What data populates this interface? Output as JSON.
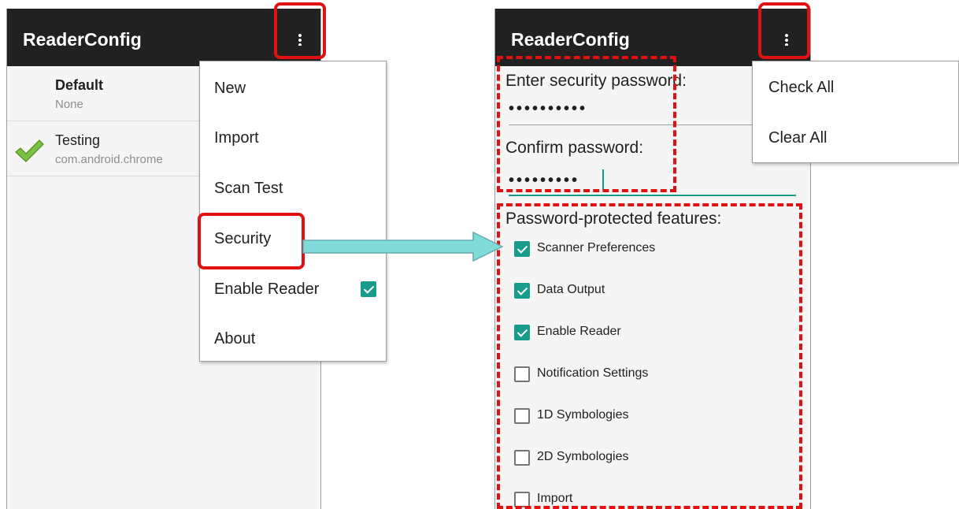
{
  "left_screen": {
    "app_title": "ReaderConfig",
    "profiles": [
      {
        "name": "Default",
        "sub": "None",
        "active": false
      },
      {
        "name": "Testing",
        "sub": "com.android.chrome",
        "active": true
      }
    ],
    "menu": {
      "items": [
        "New",
        "Import",
        "Scan Test",
        "Security",
        "Enable Reader",
        "About"
      ],
      "enable_reader_checked": true
    }
  },
  "right_screen": {
    "app_title": "ReaderConfig",
    "menu": {
      "items": [
        "Check All",
        "Clear All"
      ]
    },
    "password_label": "Enter security password:",
    "password_value": "••••••••••",
    "confirm_label": "Confirm password:",
    "confirm_value": "•••••••••",
    "features_label": "Password-protected features:",
    "features": [
      {
        "label": "Scanner Preferences",
        "checked": true
      },
      {
        "label": "Data Output",
        "checked": true
      },
      {
        "label": "Enable Reader",
        "checked": true
      },
      {
        "label": "Notification Settings",
        "checked": false
      },
      {
        "label": "1D Symbologies",
        "checked": false
      },
      {
        "label": "2D Symbologies",
        "checked": false
      },
      {
        "label": "Import",
        "checked": false
      }
    ]
  },
  "colors": {
    "accent": "#179b8b",
    "appbar": "#212121",
    "highlight": "#e21111",
    "arrow": "#7fdcd8"
  }
}
